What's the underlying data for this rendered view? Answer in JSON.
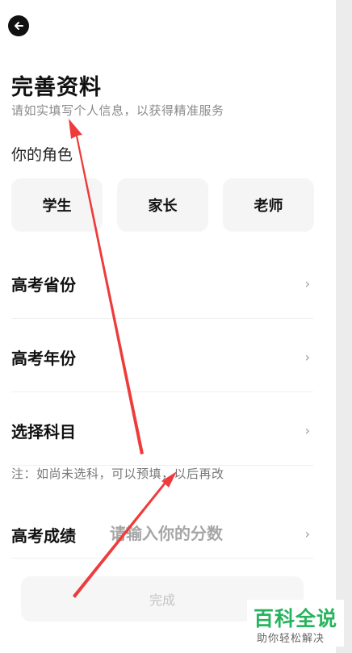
{
  "page": {
    "title": "完善资料",
    "subtitle": "请如实填写个人信息，以获得精准服务"
  },
  "role": {
    "label": "你的角色",
    "options": [
      "学生",
      "家长",
      "老师"
    ]
  },
  "rows": [
    {
      "label": "高考省份",
      "chevron": "›"
    },
    {
      "label": "高考年份",
      "chevron": "›"
    },
    {
      "label": "选择科目",
      "chevron": "›"
    }
  ],
  "note": "注：如尚未选科，可以预填，以后再改",
  "score": {
    "label": "高考成绩",
    "placeholder": "请输入你的分数",
    "chevron": "›"
  },
  "submit": {
    "label": "完成"
  },
  "colors": {
    "accent": "#27b35e",
    "annotation": "#ee3b3b"
  },
  "icons": {
    "back": "arrow-left-icon"
  },
  "watermark": {
    "logo": "百科全说",
    "tagline": "助你轻松解决"
  }
}
